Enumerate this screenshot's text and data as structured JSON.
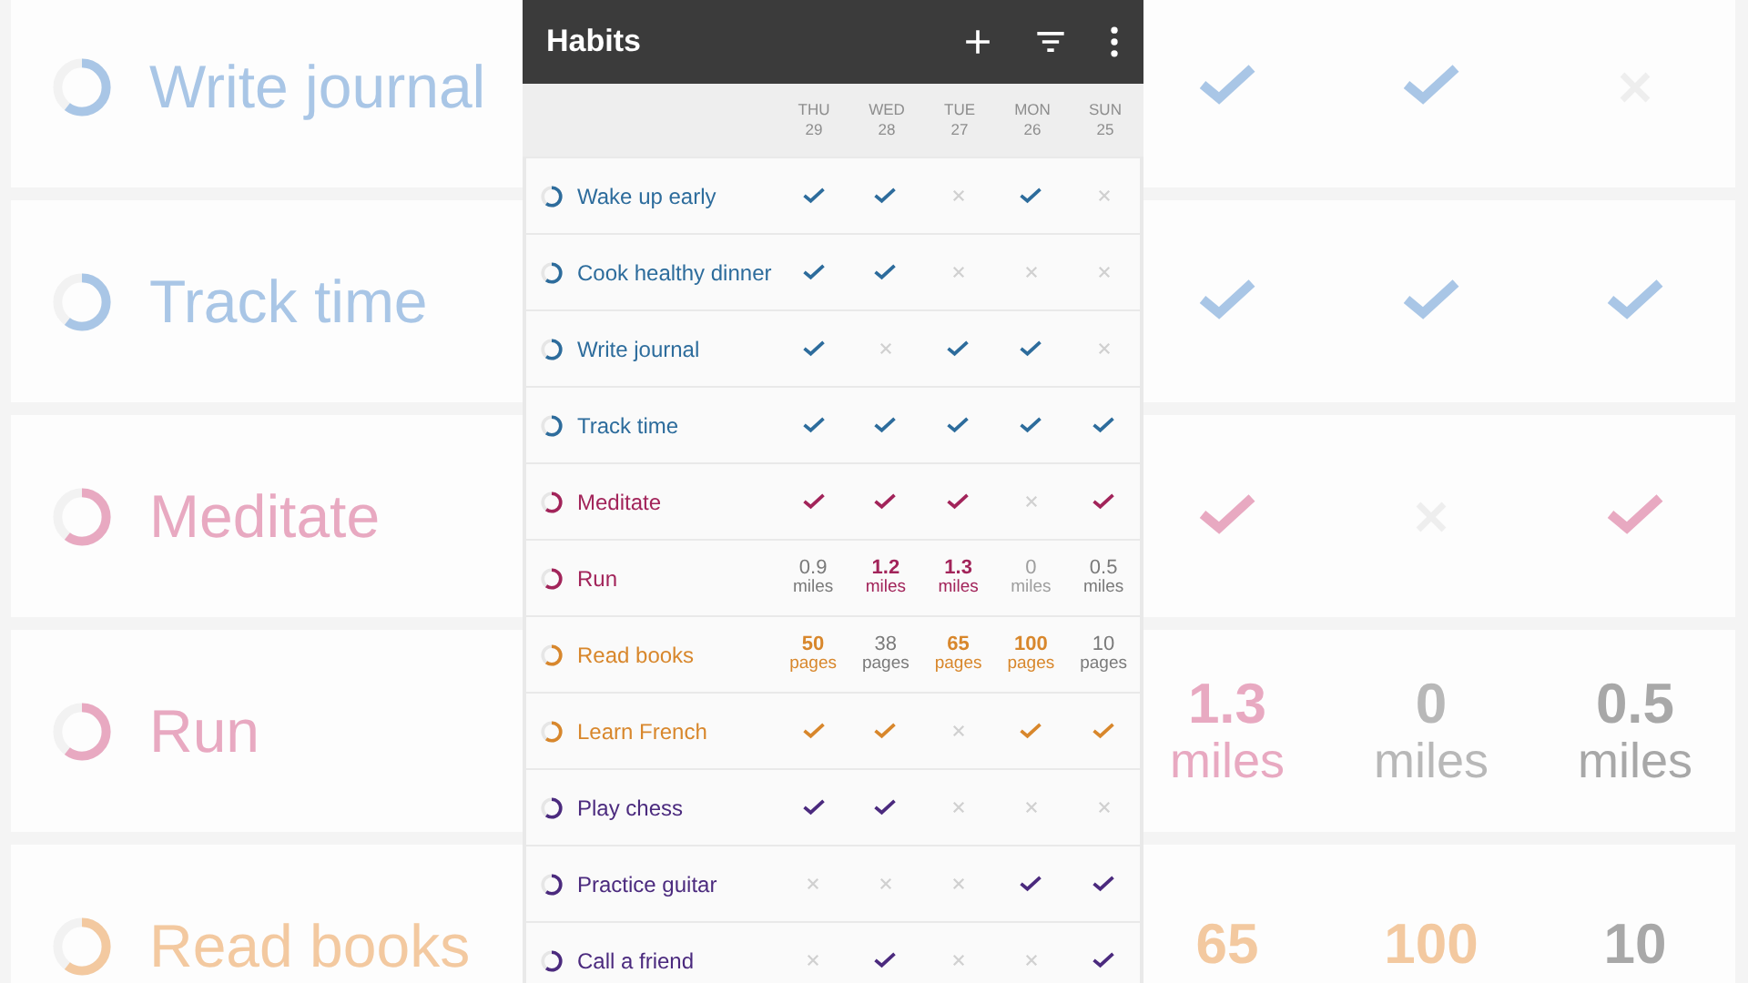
{
  "backdrop": {
    "rows": [
      {
        "name": "Write journal",
        "color": "#a9c6e6",
        "cells": [
          {
            "kind": "check",
            "done": true
          },
          {
            "kind": "check",
            "done": true
          },
          {
            "kind": "check",
            "done": false
          }
        ]
      },
      {
        "name": "Track time",
        "color": "#a9c6e6",
        "cells": [
          {
            "kind": "check",
            "done": true
          },
          {
            "kind": "check",
            "done": true
          },
          {
            "kind": "check",
            "done": true
          }
        ]
      },
      {
        "name": "Meditate",
        "color": "#e8a9c1",
        "cells": [
          {
            "kind": "check",
            "done": true
          },
          {
            "kind": "check",
            "done": false
          },
          {
            "kind": "check",
            "done": true
          }
        ]
      },
      {
        "name": "Run",
        "color": "#e8a9c1",
        "cells": [
          {
            "kind": "number",
            "value": "1.3",
            "unit": "miles",
            "met": true,
            "dimmed": false
          },
          {
            "kind": "number",
            "value": "0",
            "unit": "miles",
            "met": false,
            "dimmed": true
          },
          {
            "kind": "number",
            "value": "0.5",
            "unit": "miles",
            "met": false,
            "dimmed": false
          }
        ]
      },
      {
        "name": "Read books",
        "color": "#f3c9a0",
        "cells": [
          {
            "kind": "number",
            "value": "65",
            "met": true,
            "dimmed": false
          },
          {
            "kind": "number",
            "value": "100",
            "met": true,
            "dimmed": false
          },
          {
            "kind": "number",
            "value": "10",
            "met": false,
            "dimmed": false
          }
        ]
      }
    ]
  },
  "app": {
    "title": "Habits",
    "days": [
      {
        "weekday": "THU",
        "date": "29"
      },
      {
        "weekday": "WED",
        "date": "28"
      },
      {
        "weekday": "TUE",
        "date": "27"
      },
      {
        "weekday": "MON",
        "date": "26"
      },
      {
        "weekday": "SUN",
        "date": "25"
      }
    ],
    "habits": [
      {
        "name": "Wake up early",
        "color": "#2d6c9c",
        "cells": [
          {
            "kind": "check",
            "done": true
          },
          {
            "kind": "check",
            "done": true
          },
          {
            "kind": "check",
            "done": false
          },
          {
            "kind": "check",
            "done": true
          },
          {
            "kind": "check",
            "done": false
          }
        ]
      },
      {
        "name": "Cook healthy dinner",
        "color": "#2d6c9c",
        "cells": [
          {
            "kind": "check",
            "done": true
          },
          {
            "kind": "check",
            "done": true
          },
          {
            "kind": "check",
            "done": false
          },
          {
            "kind": "check",
            "done": false
          },
          {
            "kind": "check",
            "done": false
          }
        ]
      },
      {
        "name": "Write journal",
        "color": "#2d6c9c",
        "cells": [
          {
            "kind": "check",
            "done": true
          },
          {
            "kind": "check",
            "done": false
          },
          {
            "kind": "check",
            "done": true
          },
          {
            "kind": "check",
            "done": true
          },
          {
            "kind": "check",
            "done": false
          }
        ]
      },
      {
        "name": "Track time",
        "color": "#2d6c9c",
        "cells": [
          {
            "kind": "check",
            "done": true
          },
          {
            "kind": "check",
            "done": true
          },
          {
            "kind": "check",
            "done": true
          },
          {
            "kind": "check",
            "done": true
          },
          {
            "kind": "check",
            "done": true
          }
        ]
      },
      {
        "name": "Meditate",
        "color": "#a2245a",
        "cells": [
          {
            "kind": "check",
            "done": true
          },
          {
            "kind": "check",
            "done": true
          },
          {
            "kind": "check",
            "done": true
          },
          {
            "kind": "check",
            "done": false
          },
          {
            "kind": "check",
            "done": true
          }
        ]
      },
      {
        "name": "Run",
        "color": "#a2245a",
        "cells": [
          {
            "kind": "number",
            "value": "0.9",
            "unit": "miles",
            "met": false,
            "dimmed": false
          },
          {
            "kind": "number",
            "value": "1.2",
            "unit": "miles",
            "met": true,
            "dimmed": false
          },
          {
            "kind": "number",
            "value": "1.3",
            "unit": "miles",
            "met": true,
            "dimmed": false
          },
          {
            "kind": "number",
            "value": "0",
            "unit": "miles",
            "met": false,
            "dimmed": true
          },
          {
            "kind": "number",
            "value": "0.5",
            "unit": "miles",
            "met": false,
            "dimmed": false
          }
        ]
      },
      {
        "name": "Read books",
        "color": "#d8872c",
        "cells": [
          {
            "kind": "number",
            "value": "50",
            "unit": "pages",
            "met": true,
            "dimmed": false
          },
          {
            "kind": "number",
            "value": "38",
            "unit": "pages",
            "met": false,
            "dimmed": false
          },
          {
            "kind": "number",
            "value": "65",
            "unit": "pages",
            "met": true,
            "dimmed": false
          },
          {
            "kind": "number",
            "value": "100",
            "unit": "pages",
            "met": true,
            "dimmed": false
          },
          {
            "kind": "number",
            "value": "10",
            "unit": "pages",
            "met": false,
            "dimmed": false
          }
        ]
      },
      {
        "name": "Learn French",
        "color": "#d8872c",
        "cells": [
          {
            "kind": "check",
            "done": true
          },
          {
            "kind": "check",
            "done": true
          },
          {
            "kind": "check",
            "done": false
          },
          {
            "kind": "check",
            "done": true
          },
          {
            "kind": "check",
            "done": true
          }
        ]
      },
      {
        "name": "Play chess",
        "color": "#4b2a7e",
        "cells": [
          {
            "kind": "check",
            "done": true
          },
          {
            "kind": "check",
            "done": true
          },
          {
            "kind": "check",
            "done": false
          },
          {
            "kind": "check",
            "done": false
          },
          {
            "kind": "check",
            "done": false
          }
        ]
      },
      {
        "name": "Practice guitar",
        "color": "#4b2a7e",
        "cells": [
          {
            "kind": "check",
            "done": false
          },
          {
            "kind": "check",
            "done": false
          },
          {
            "kind": "check",
            "done": false
          },
          {
            "kind": "check",
            "done": true
          },
          {
            "kind": "check",
            "done": true
          }
        ]
      },
      {
        "name": "Call a friend",
        "color": "#4b2a7e",
        "cells": [
          {
            "kind": "check",
            "done": false
          },
          {
            "kind": "check",
            "done": true
          },
          {
            "kind": "check",
            "done": false
          },
          {
            "kind": "check",
            "done": false
          },
          {
            "kind": "check",
            "done": true
          }
        ]
      }
    ]
  }
}
